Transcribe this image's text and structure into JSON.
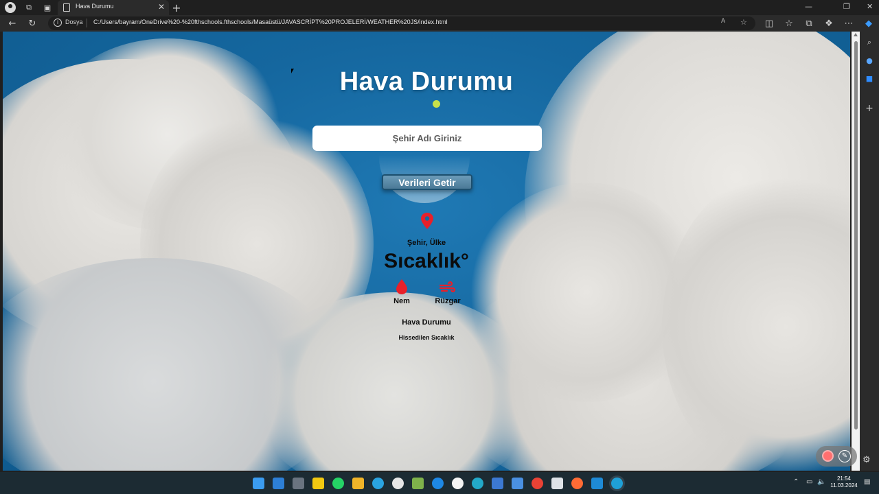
{
  "browser": {
    "tab_title": "Hava Durumu",
    "tab_close": "✕",
    "new_tab": "+",
    "url_scheme_label": "Dosya",
    "url": "C:/Users/bayram/OneDrive%20-%20fthschools.fthschools/Masaüstü/JAVASCRİPT%20PROJELERİ/WEATHER%20JS/index.html",
    "min": "—",
    "restore": "❐",
    "close": "✕"
  },
  "app": {
    "title": "Hava Durumu",
    "search_placeholder": "Şehir Adı Giriniz",
    "fetch_button": "Verileri Getir",
    "location_text": "Şehir, Ülke",
    "temperature_text": "Sıcaklık°",
    "humidity_text": "Nem",
    "wind_text": "Rüzgar",
    "description_text": "Hava Durumu",
    "feels_like_text": "Hissedilen Sıcaklık"
  },
  "taskbar": {
    "time": "21:54",
    "date": "11.03.2024"
  },
  "colors": {
    "sky": "#15679f",
    "accent_red": "#e8202a",
    "button": "#5a89a6",
    "title_dot": "#c7e14a"
  }
}
